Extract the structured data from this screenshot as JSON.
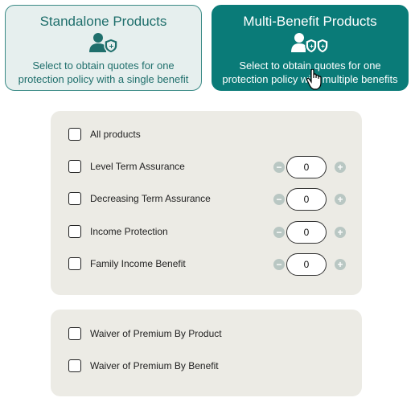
{
  "cards": {
    "standalone": {
      "title": "Standalone Products",
      "description": "Select to obtain quotes for one protection policy with a single benefit",
      "icon": "person-shield-icon"
    },
    "multi": {
      "title": "Multi-Benefit Products",
      "description": "Select to obtain quotes for one protection policy with multiple benefits",
      "icon": "person-double-shield-icon"
    }
  },
  "products": {
    "all_label": "All products",
    "items": [
      {
        "label": "Level Term Assurance",
        "value": "0"
      },
      {
        "label": "Decreasing Term Assurance",
        "value": "0"
      },
      {
        "label": "Income Protection",
        "value": "0"
      },
      {
        "label": "Family Income Benefit",
        "value": "0"
      }
    ]
  },
  "waivers": {
    "items": [
      {
        "label": "Waiver of Premium By Product"
      },
      {
        "label": "Waiver of Premium By Benefit"
      }
    ]
  },
  "colors": {
    "accent": "#0a7b78",
    "card_light": "#e6efee",
    "panel": "#ecebe5",
    "stepper_btn": "#b9c7c3"
  }
}
